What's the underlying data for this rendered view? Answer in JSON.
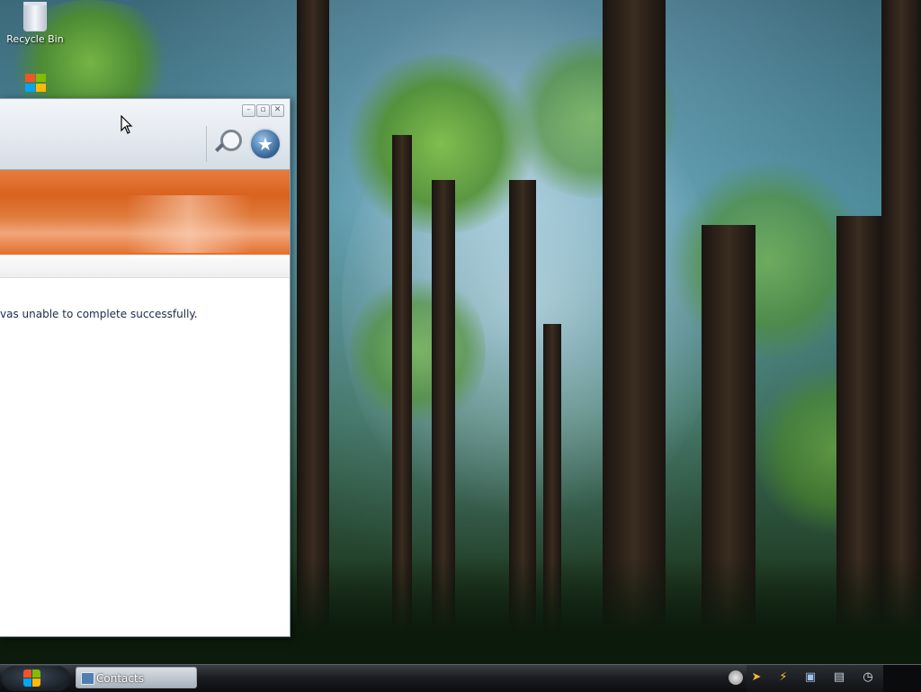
{
  "desktop": {
    "icons": [
      {
        "label": "Recycle Bin",
        "icon": "recycle-bin-icon"
      },
      {
        "label": "",
        "icon": "windows-shortcut-icon"
      }
    ]
  },
  "window": {
    "controls": {
      "minimize": "–",
      "maximize": "▫",
      "close": "✕"
    },
    "search_icon": "search-icon",
    "star_icon": "★",
    "message": "vas unable to complete successfully."
  },
  "taskbar": {
    "start_icon": "windows-orb-icon",
    "tasks": [
      {
        "label": "Contacts",
        "icon": "contacts-icon"
      }
    ],
    "tray_icons": [
      "arrow-icon",
      "lightning-icon",
      "gadget-icon",
      "network-icon",
      "clock-icon"
    ]
  },
  "colors": {
    "banner_orange": "#e36e2c",
    "message_text": "#1b2b4a"
  }
}
